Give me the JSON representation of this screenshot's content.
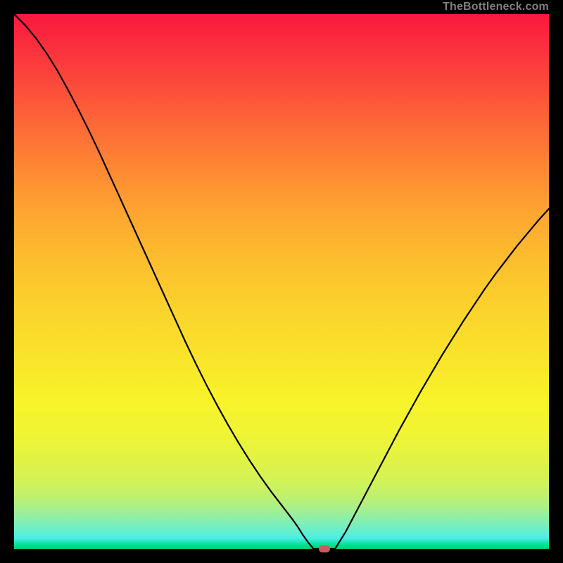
{
  "watermark": "TheBottleneck.com",
  "colors": {
    "marker": "#cc5c59",
    "curve": "#000000",
    "gradient_top": "#fb183f",
    "gradient_bottom": "#00cf72",
    "frame": "#000000"
  },
  "chart_data": {
    "type": "line",
    "title": "",
    "xlabel": "",
    "ylabel": "",
    "xlim": [
      0,
      100
    ],
    "ylim": [
      0,
      100
    ],
    "x": [
      0,
      2,
      4,
      6,
      8,
      10,
      12,
      14,
      16,
      18,
      20,
      22,
      24,
      26,
      28,
      30,
      32,
      34,
      36,
      38,
      40,
      42,
      44,
      46,
      48,
      50,
      51,
      52,
      53,
      54,
      55,
      56,
      58,
      60,
      62,
      64,
      66,
      68,
      70,
      72,
      74,
      76,
      78,
      80,
      82,
      84,
      86,
      88,
      90,
      92,
      94,
      96,
      98,
      100
    ],
    "values": [
      100,
      98.0,
      95.6,
      92.8,
      89.6,
      86.0,
      82.2,
      78.2,
      74.0,
      69.6,
      65.2,
      60.8,
      56.4,
      52.0,
      47.6,
      43.2,
      38.8,
      34.6,
      30.6,
      26.8,
      23.2,
      19.8,
      16.6,
      13.6,
      10.8,
      8.2,
      6.9,
      5.6,
      4.2,
      2.6,
      1.2,
      0.0,
      0.0,
      0.0,
      3.2,
      7.0,
      10.8,
      14.6,
      18.4,
      22.2,
      25.8,
      29.4,
      32.8,
      36.2,
      39.4,
      42.6,
      45.6,
      48.6,
      51.4,
      54.0,
      56.6,
      59.0,
      61.4,
      63.6
    ],
    "marker": {
      "x": 58,
      "y": 0
    },
    "grid": false,
    "legend": false,
    "annotations": []
  }
}
